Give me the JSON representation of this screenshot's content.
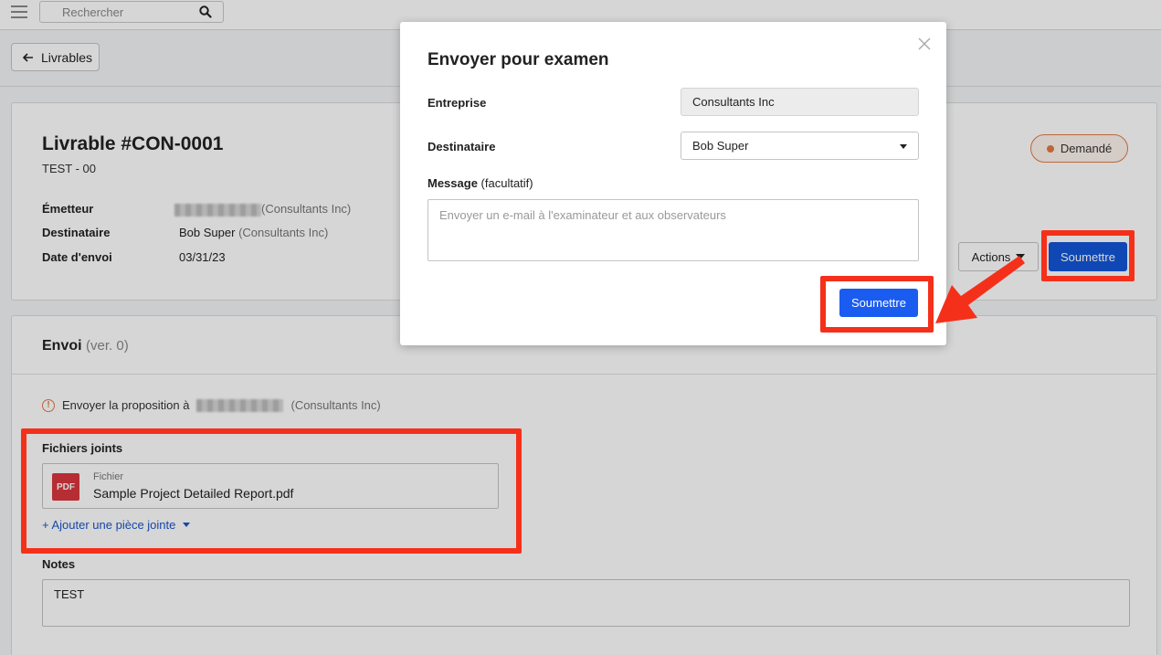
{
  "topbar": {
    "search_placeholder": "Rechercher"
  },
  "nav": {
    "back_label": "Livrables"
  },
  "deliverable": {
    "title": "Livrable #CON-0001",
    "subtitle": "TEST - 00",
    "status": "Demandé",
    "status_color": "#e07b43",
    "sender_label": "Émetteur",
    "sender_company": "(Consultants Inc)",
    "recipient_label": "Destinataire",
    "recipient_name": "Bob Super",
    "recipient_company": "(Consultants Inc)",
    "sent_date_label": "Date d'envoi",
    "sent_date": "03/31/23",
    "actions_label": "Actions",
    "submit_label": "Soumettre"
  },
  "submission": {
    "title": "Envoi",
    "version": "(ver. 0)",
    "warning_text": "Envoyer la proposition à",
    "warning_company": "(Consultants Inc)",
    "files_label": "Fichiers joints",
    "file_type": "Fichier",
    "file_name": "Sample Project Detailed Report.pdf",
    "file_icon_text": "PDF",
    "add_attachment": "+ Ajouter une pièce jointe",
    "notes_label": "Notes",
    "notes_value": "TEST"
  },
  "modal": {
    "title": "Envoyer pour examen",
    "company_label": "Entreprise",
    "company_value": "Consultants Inc",
    "recipient_label": "Destinataire",
    "recipient_value": "Bob Super",
    "message_label": "Message",
    "message_optional": "(facultatif)",
    "message_placeholder": "Envoyer un e-mail à l'examinateur et aux observateurs",
    "submit_label": "Soumettre"
  },
  "colors": {
    "primary": "#1a5cf0",
    "highlight": "#f5301a"
  }
}
